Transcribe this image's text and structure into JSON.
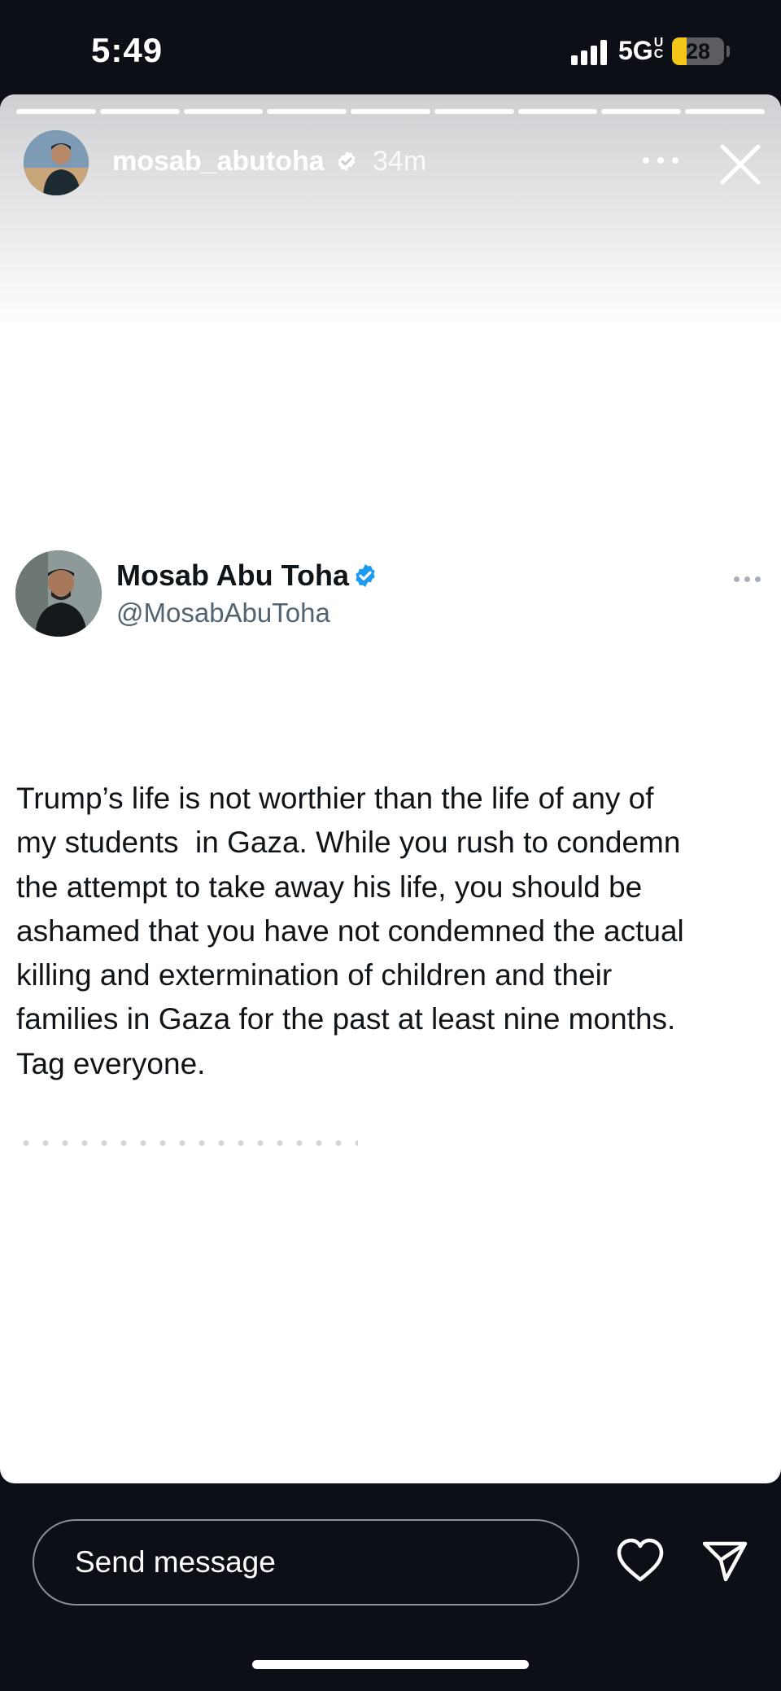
{
  "status_bar": {
    "time": "5:49",
    "network": "5GUC",
    "battery_level": "28",
    "battery_fraction": 0.28
  },
  "story": {
    "username": "mosab_abutoha",
    "time_ago": "34m",
    "segments_total": 9,
    "colors": {
      "progress": "#ffffff",
      "card_bg": "#ffffff"
    }
  },
  "tweet": {
    "display_name": "Mosab Abu Toha",
    "handle": "@MosabAbuToha",
    "text": "Trump’s life is not worthier than the life of any of\nmy students  in Gaza. While you rush to condemn\nthe attempt to take away his life, you should be\nashamed that you have not condemned the actual\nkilling and extermination of children and their\nfamilies in Gaza for the past at least nine months.\nTag everyone.",
    "colors": {
      "verified": "#1d9bf0",
      "text": "#0f1419",
      "handle": "#536471"
    }
  },
  "reply": {
    "placeholder": "Send message"
  },
  "icons": {
    "close": "close-icon",
    "more": "more-options-icon",
    "like": "heart-icon",
    "send": "send-icon",
    "verified": "verified-badge-icon"
  }
}
